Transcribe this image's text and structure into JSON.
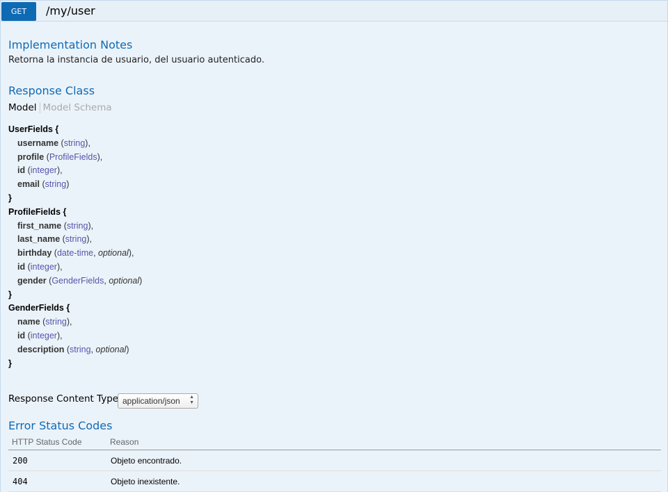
{
  "endpoint": {
    "method": "GET",
    "path": "/my/user"
  },
  "implementation_notes": {
    "title": "Implementation Notes",
    "text": "Retorna la instancia de usuario, del usuario autenticado."
  },
  "response_class": {
    "title": "Response Class",
    "tab_model": "Model",
    "tab_schema": "Model Schema"
  },
  "models": [
    {
      "name": "UserFields",
      "fields": [
        {
          "name": "username",
          "type": "string",
          "optional": "",
          "sep": "),"
        },
        {
          "name": "profile",
          "type": "ProfileFields",
          "optional": "",
          "sep": "),"
        },
        {
          "name": "id",
          "type": "integer",
          "optional": "",
          "sep": "),"
        },
        {
          "name": "email",
          "type": "string",
          "optional": "",
          "sep": ")"
        }
      ]
    },
    {
      "name": "ProfileFields",
      "fields": [
        {
          "name": "first_name",
          "type": "string",
          "optional": "",
          "sep": "),"
        },
        {
          "name": "last_name",
          "type": "string",
          "optional": "",
          "sep": "),"
        },
        {
          "name": "birthday",
          "type": "date-time",
          "optional": "optional",
          "sep": "),"
        },
        {
          "name": "id",
          "type": "integer",
          "optional": "",
          "sep": "),"
        },
        {
          "name": "gender",
          "type": "GenderFields",
          "optional": "optional",
          "sep": ")"
        }
      ]
    },
    {
      "name": "GenderFields",
      "fields": [
        {
          "name": "name",
          "type": "string",
          "optional": "",
          "sep": "),"
        },
        {
          "name": "id",
          "type": "integer",
          "optional": "",
          "sep": "),"
        },
        {
          "name": "description",
          "type": "string",
          "optional": "optional",
          "sep": ")"
        }
      ]
    }
  ],
  "response_content_type": {
    "label": "Response Content Type",
    "selected": "application/json"
  },
  "error_status_codes": {
    "title": "Error Status Codes",
    "col_code": "HTTP Status Code",
    "col_reason": "Reason",
    "rows": [
      {
        "code": "200",
        "reason": "Objeto encontrado."
      },
      {
        "code": "404",
        "reason": "Objeto inexistente."
      }
    ]
  },
  "colors": {
    "get_badge": "#0f6ab4",
    "heading_text": "#0f6ab4",
    "background": "#ebf3fa",
    "type_link": "#5555aa"
  }
}
